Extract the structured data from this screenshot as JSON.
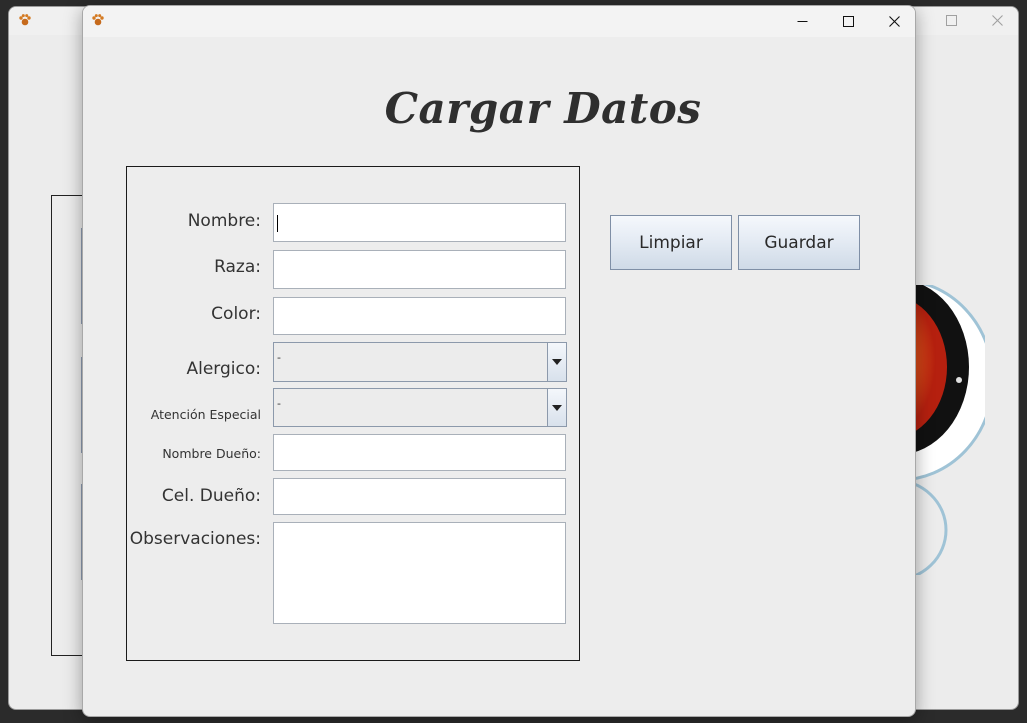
{
  "dialog": {
    "title": "Cargar Datos",
    "app_icon": "paw-icon",
    "window_controls": [
      "minimize",
      "maximize",
      "close"
    ]
  },
  "form": {
    "nombre_label": "Nombre:",
    "raza_label": "Raza:",
    "color_label": "Color:",
    "alergico_label": "Alergico:",
    "alergico_value": "-",
    "atencion_label": "Atención Especial",
    "atencion_value": "-",
    "nombre_dueno_label": "Nombre Dueño:",
    "cel_dueno_label": "Cel. Dueño:",
    "observaciones_label": "Observaciones:",
    "nombre_value": "",
    "raza_value": "",
    "color_value": "",
    "nombre_dueno_value": "",
    "cel_dueno_value": "",
    "observaciones_value": ""
  },
  "actions": {
    "limpiar_label": "Limpiar",
    "guardar_label": "Guardar"
  },
  "colors": {
    "dialog_bg": "#ededed",
    "button_border": "#7f8fa6",
    "title_text": "#2f2f2f"
  }
}
